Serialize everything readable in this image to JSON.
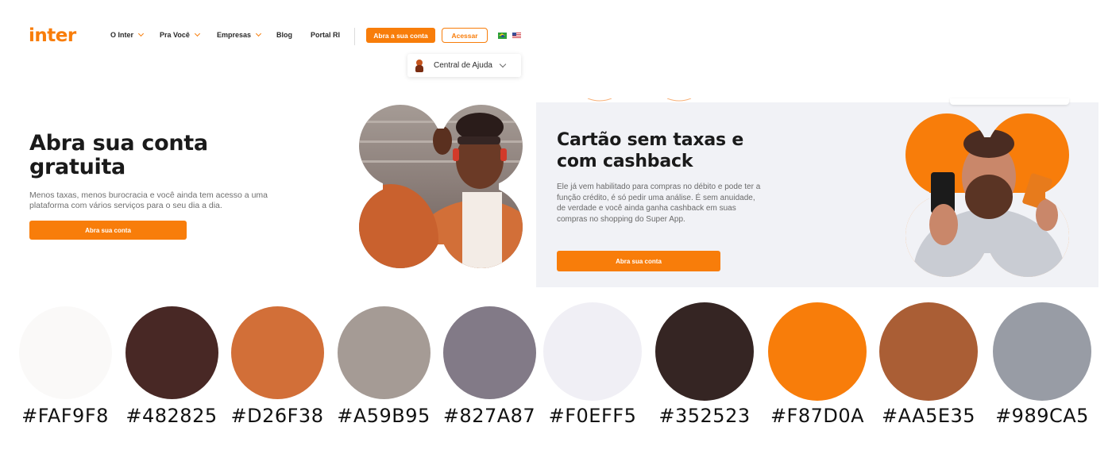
{
  "header": {
    "logo": "inter",
    "nav": [
      {
        "label": "O Inter",
        "dropdown": true
      },
      {
        "label": "Pra Você",
        "dropdown": true
      },
      {
        "label": "Empresas",
        "dropdown": true
      },
      {
        "label": "Blog",
        "dropdown": false
      },
      {
        "label": "Portal RI",
        "dropdown": false
      }
    ],
    "open_account_button": "Abra a sua conta",
    "access_button": "Acessar",
    "languages": [
      "flag-brazil-icon",
      "flag-usa-icon"
    ]
  },
  "help_widget": {
    "label": "Central de Ajuda",
    "icon": "assistant-avatar-icon"
  },
  "hero_left": {
    "title": "Abra sua conta gratuita",
    "description": "Menos taxas, menos burocracia e você ainda tem acesso a uma plataforma com vários serviços para o seu dia a dia.",
    "cta": "Abra sua conta",
    "image": "man-with-headphones-photo"
  },
  "hero_right": {
    "title": "Cartão sem taxas e com cashback",
    "description": "Ele já vem habilitado para compras no débito e pode ter a função crédito, é só pedir uma análise. É sem anuidade, de verdade e você ainda ganha cashback em suas compras no shopping do Super App.",
    "cta": "Abra sua conta",
    "image": "bearded-man-with-phone-and-card-photo"
  },
  "palette": [
    {
      "hex": "#FAF9F8",
      "color": "#FAF9F8"
    },
    {
      "hex": "#482825",
      "color": "#482825"
    },
    {
      "hex": "#D26F38",
      "color": "#D26F38"
    },
    {
      "hex": "#A59B95",
      "color": "#A59B95"
    },
    {
      "hex": "#827A87",
      "color": "#827A87"
    },
    {
      "hex": "#F0EFF5",
      "color": "#F0EFF5"
    },
    {
      "hex": "#352523",
      "color": "#352523"
    },
    {
      "hex": "#F87D0A",
      "color": "#F87D0A"
    },
    {
      "hex": "#AA5E35",
      "color": "#AA5E35"
    },
    {
      "hex": "#989CA5",
      "color": "#989CA5"
    }
  ],
  "colors": {
    "brand_orange": "#F87D0A",
    "panel_background": "#F1F2F6"
  }
}
